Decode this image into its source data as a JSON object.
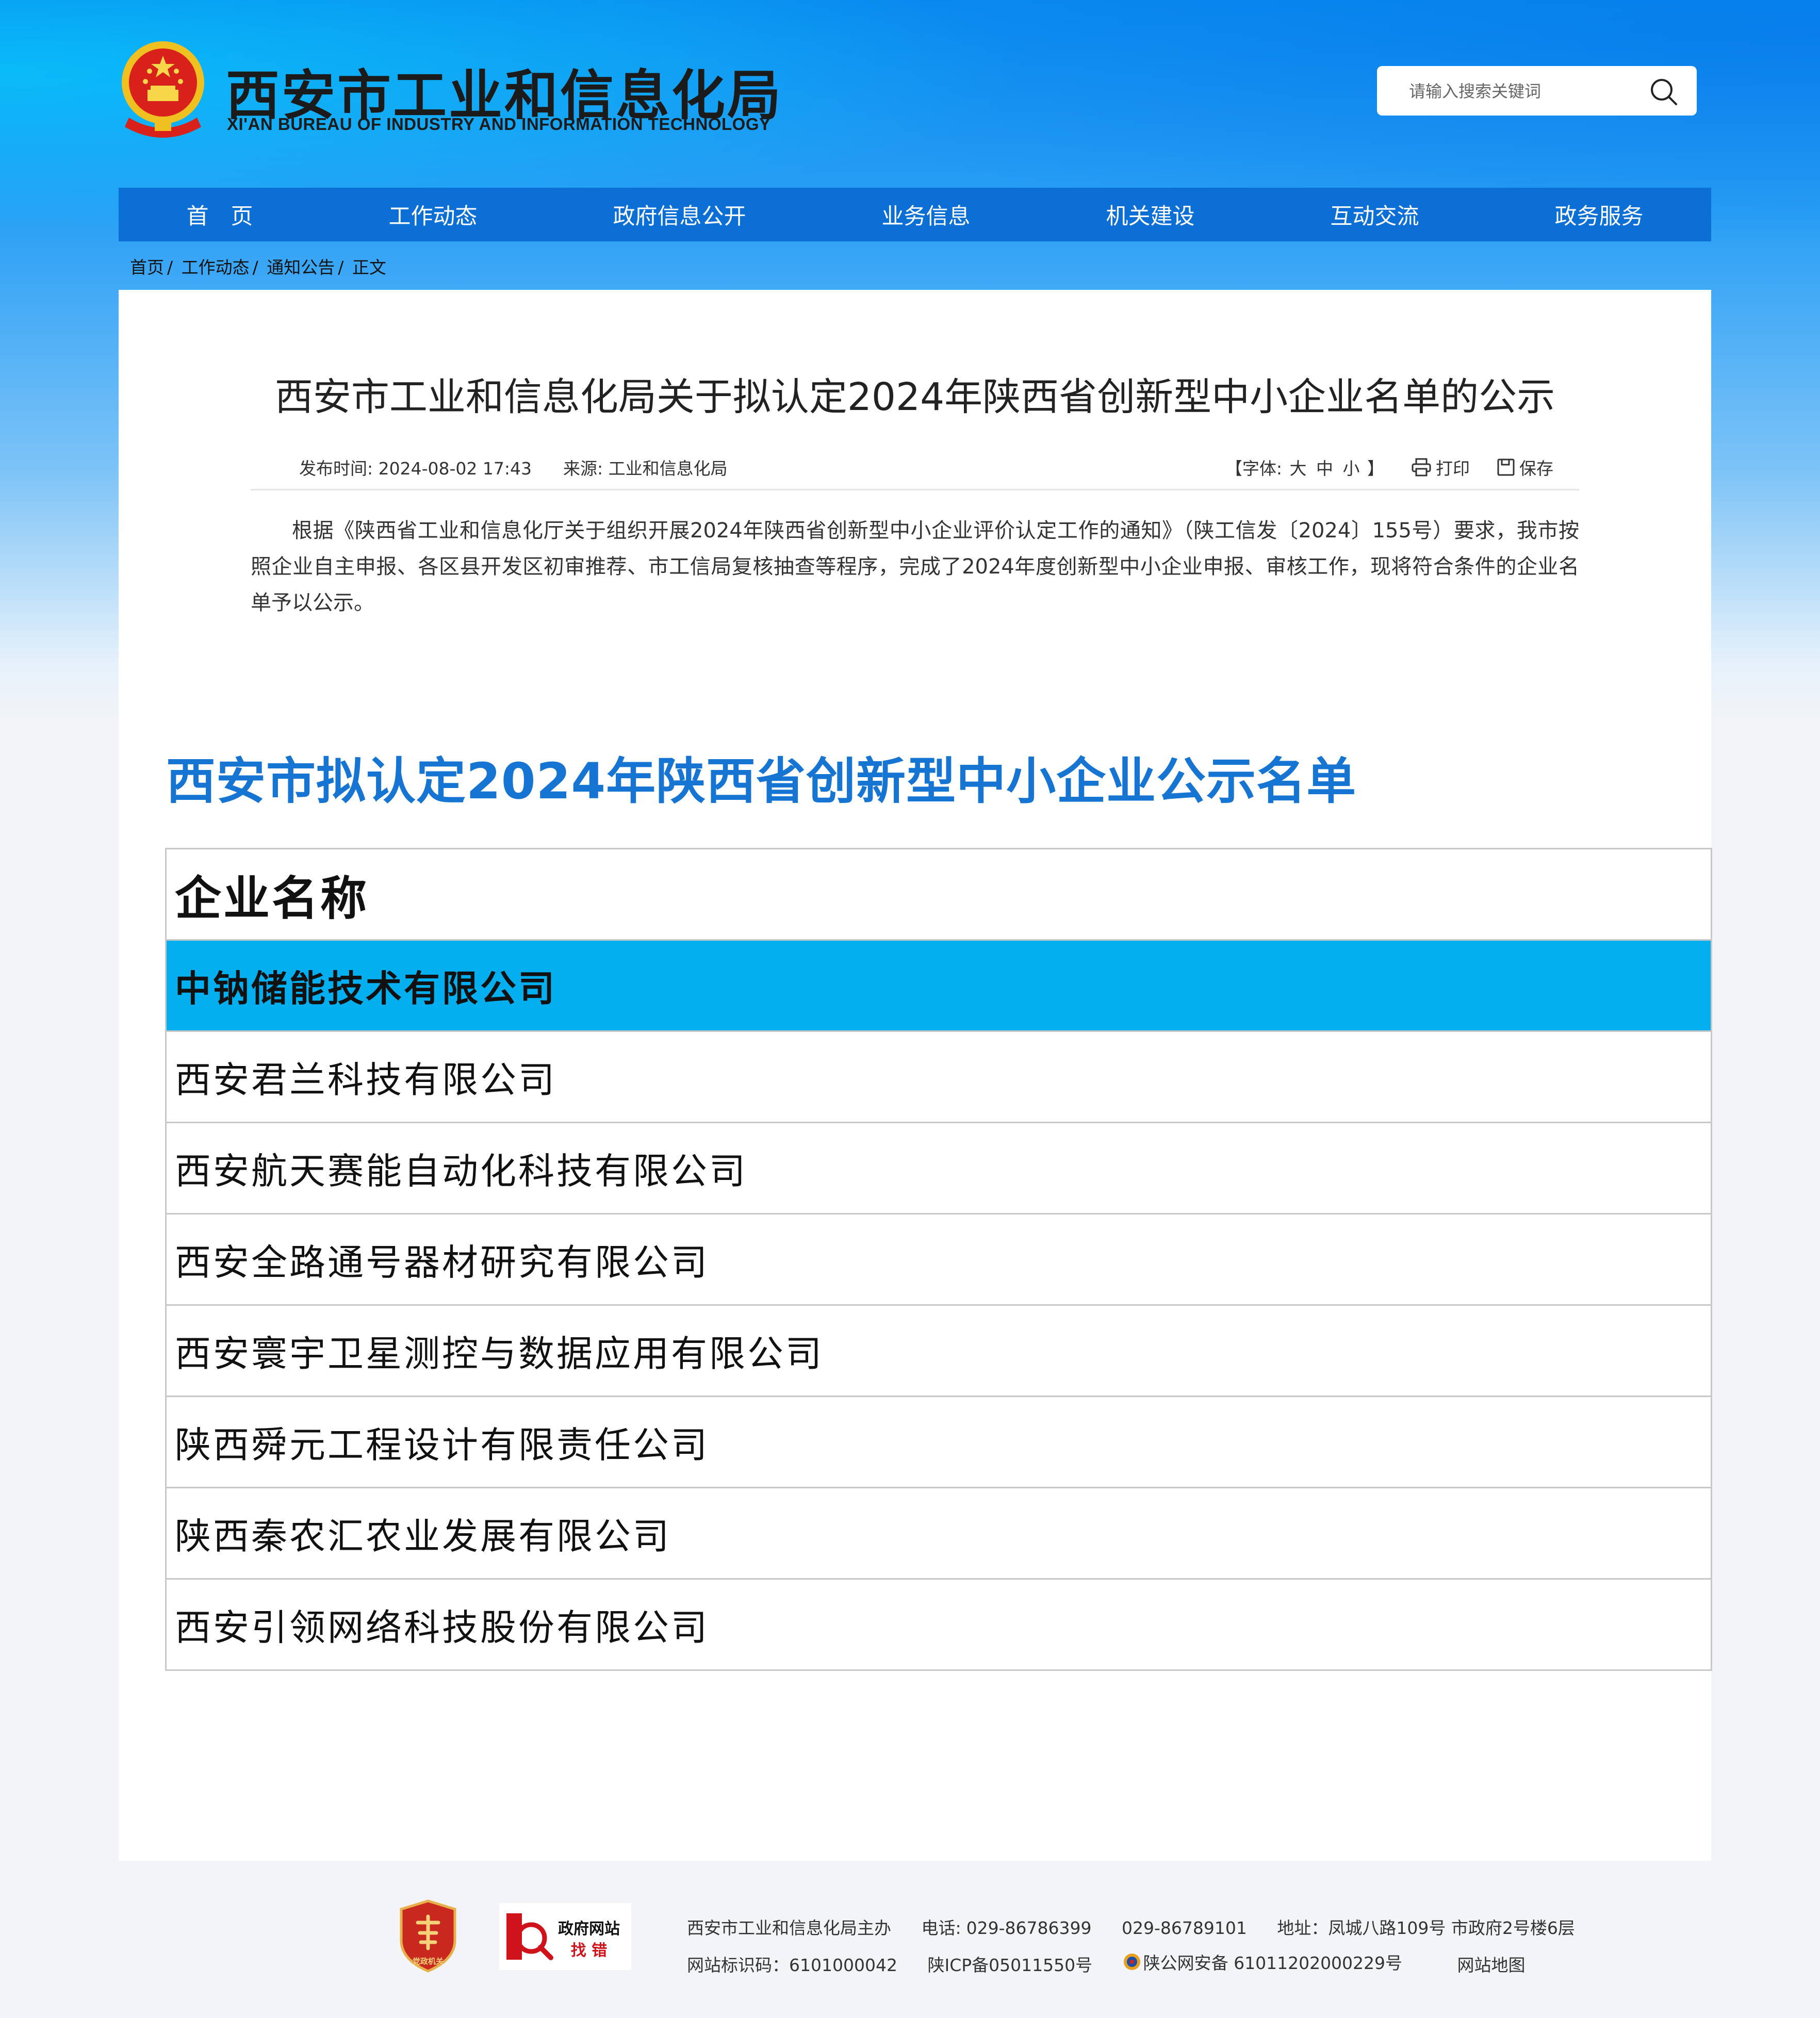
{
  "header": {
    "site_name_cn": "西安市工业和信息化局",
    "site_name_en": "XI'AN BUREAU OF INDUSTRY AND INFORMATION TECHNOLOGY",
    "search_placeholder": "请输入搜索关键词"
  },
  "nav": {
    "items": [
      "首　页",
      "工作动态",
      "政府信息公开",
      "业务信息",
      "机关建设",
      "互动交流",
      "政务服务"
    ]
  },
  "breadcrumb": [
    "首页",
    "工作动态",
    "通知公告",
    "正文"
  ],
  "breadcrumb_separator": "/",
  "article": {
    "title": "西安市工业和信息化局关于拟认定2024年陕西省创新型中小企业名单的公示",
    "publish_label": "发布时间:",
    "publish_time": "2024-08-02 17:43",
    "source_label": "来源:",
    "source": "工业和信息化局",
    "font_label_open": "【字体:",
    "font_large": "大",
    "font_medium": "中",
    "font_small": "小",
    "font_label_close": "】",
    "print_label": "打印",
    "save_label": "保存",
    "body": "根据《陕西省工业和信息化厅关于组织开展2024年陕西省创新型中小企业评价认定工作的通知》（陕工信发〔2024〕155号）要求，我市按照企业自主申报、各区县开发区初审推荐、市工信局复核抽查等程序，完成了2024年度创新型中小企业申报、审核工作，现将符合条件的企业名单予以公示。"
  },
  "list": {
    "title": "西安市拟认定2024年陕西省创新型中小企业公示名单",
    "header": "企业名称",
    "rows": [
      "中钠储能技术有限公司",
      "西安君兰科技有限公司",
      "西安航天赛能自动化科技有限公司",
      "西安全路通号器材研究有限公司",
      "西安寰宇卫星测控与数据应用有限公司",
      "陕西舜元工程设计有限责任公司",
      "陕西秦农汇农业发展有限公司",
      "西安引领网络科技股份有限公司"
    ],
    "highlight_color": "#04aff0"
  },
  "footer": {
    "badge1_text": "党政机关",
    "badge2_line1": "政府网站",
    "badge2_line2": "找 错",
    "sponsor": "西安市工业和信息化局主办",
    "phone_label": "电话:",
    "phone1": "029-86786399",
    "phone2": "029-86789101",
    "address": "地址：凤城八路109号 市政府2号楼6层",
    "site_code": "网站标识码：6101000042",
    "icp": "陕ICP备05011550号",
    "psb": "陕公网安备 61011202000229号",
    "sitemap": "网站地图"
  },
  "colors": {
    "nav_bg": "#0b6fd6",
    "list_title": "#1674d2",
    "row_highlight": "#04aff0"
  }
}
